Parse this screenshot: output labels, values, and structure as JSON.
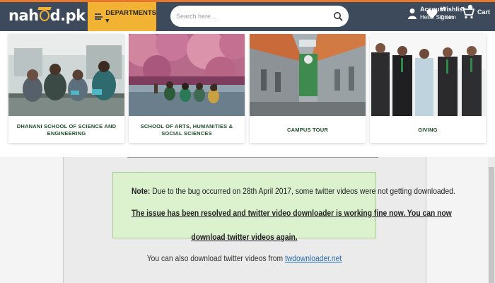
{
  "header": {
    "logo_text_left": "nah",
    "logo_text_right": "d.pk",
    "departments_label": "DEPARTMENTS ▾",
    "search_placeholder": "Search here...",
    "account_title": "Account",
    "account_sub": "Hello! Sign in",
    "wishlist_title": "Wishlist",
    "wishlist_sub": "0 item",
    "cart_label": "Cart",
    "accent_color": "#e8772e",
    "bar_color": "#3c4a5c",
    "departments_color": "#f2b233"
  },
  "cards": [
    {
      "label": "DHANANI SCHOOL OF SCIENCE AND ENGINEERING",
      "image": "science-lab-photo"
    },
    {
      "label": "SCHOOL OF ARTS, HUMANITIES & SOCIAL SCIENCES",
      "image": "students-under-pink-trees-photo"
    },
    {
      "label": "CAMPUS TOUR",
      "image": "campus-courtyard-photo"
    },
    {
      "label": "GIVING",
      "image": "group-of-donors-photo"
    }
  ],
  "notice": {
    "note_label": "Note:",
    "line1": " Due to the bug occurred on 28th April 2017, some twitter videos were not getting downloaded.",
    "line2": "The issue has been resolved and twitter video downloader is working fine now. You can now",
    "line3": "download twitter videos again.",
    "alt_text": "You can also download twitter videos from ",
    "alt_link": "twdownloader.net"
  }
}
